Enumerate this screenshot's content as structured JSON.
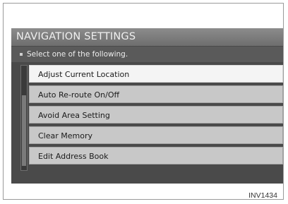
{
  "screen": {
    "title": "NAVIGATION SETTINGS",
    "subtitle": "Select one of the following.",
    "menu": [
      {
        "label": "Adjust Current Location",
        "selected": true
      },
      {
        "label": "Auto Re-route On/Off",
        "selected": false
      },
      {
        "label": "Avoid Area Setting",
        "selected": false
      },
      {
        "label": "Clear Memory",
        "selected": false
      },
      {
        "label": "Edit Address Book",
        "selected": false
      }
    ]
  },
  "caption": "INV1434"
}
